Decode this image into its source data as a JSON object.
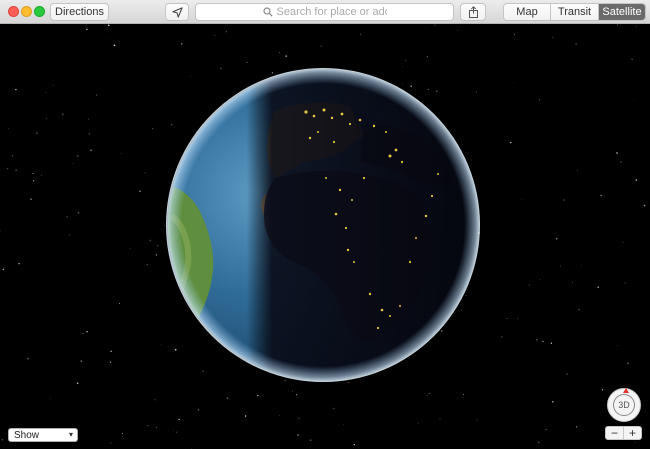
{
  "toolbar": {
    "directions_label": "Directions",
    "search_placeholder": "Search for place or address",
    "map_modes": [
      {
        "label": "Map",
        "selected": false
      },
      {
        "label": "Transit",
        "selected": false
      },
      {
        "label": "Satellite",
        "selected": true
      }
    ],
    "icons": {
      "location": "location-arrow-icon",
      "search": "magnifier-icon",
      "share": "share-icon"
    }
  },
  "controls": {
    "show_menu_label": "Show",
    "compass_label": "3D",
    "zoom_out_label": "−",
    "zoom_in_label": "+"
  },
  "colors": {
    "selected_segment": "#6a6a6a",
    "compass_north": "#e0322c",
    "city_lights": "#ffd84a"
  }
}
